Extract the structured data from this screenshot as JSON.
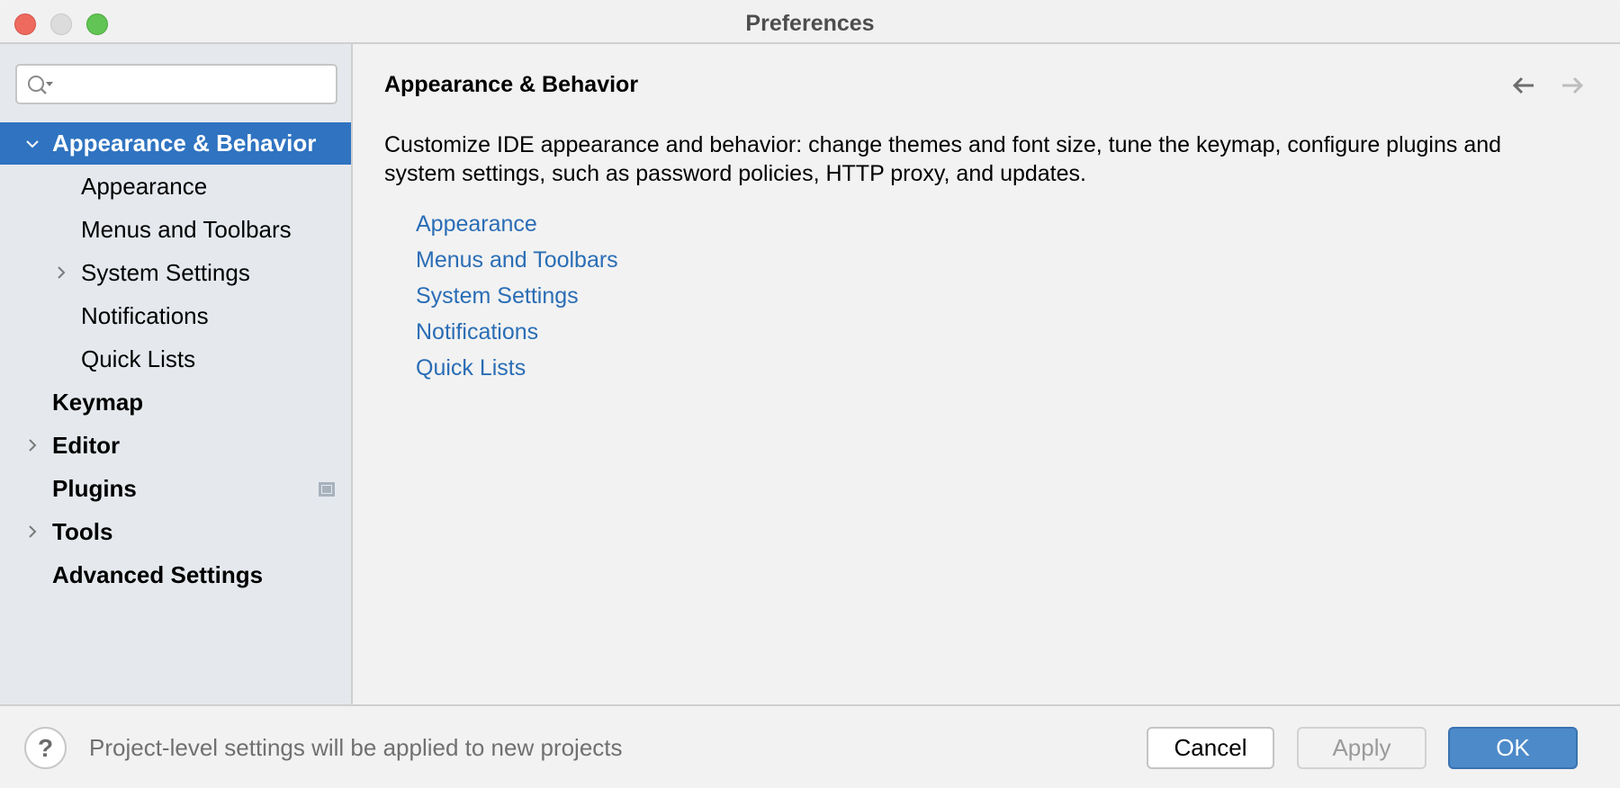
{
  "window": {
    "title": "Preferences",
    "controls": [
      "close",
      "minimize",
      "maximize"
    ]
  },
  "sidebar": {
    "search": {
      "value": "",
      "placeholder": ""
    },
    "tree": [
      {
        "label": "Appearance & Behavior",
        "level": 0,
        "expandable": true,
        "expanded": true,
        "selected": true,
        "bold": true
      },
      {
        "label": "Appearance",
        "level": 1,
        "expandable": false
      },
      {
        "label": "Menus and Toolbars",
        "level": 1,
        "expandable": false
      },
      {
        "label": "System Settings",
        "level": 1,
        "expandable": true,
        "expanded": false
      },
      {
        "label": "Notifications",
        "level": 1,
        "expandable": false
      },
      {
        "label": "Quick Lists",
        "level": 1,
        "expandable": false
      },
      {
        "label": "Keymap",
        "level": 0,
        "expandable": false,
        "bold": true
      },
      {
        "label": "Editor",
        "level": 0,
        "expandable": true,
        "expanded": false,
        "bold": true
      },
      {
        "label": "Plugins",
        "level": 0,
        "expandable": false,
        "bold": true,
        "badge": "window-icon"
      },
      {
        "label": "Tools",
        "level": 0,
        "expandable": true,
        "expanded": false,
        "bold": true
      },
      {
        "label": "Advanced Settings",
        "level": 0,
        "expandable": false,
        "bold": true
      }
    ]
  },
  "content": {
    "title": "Appearance & Behavior",
    "nav": {
      "back_icon": "arrow-left-icon",
      "back_enabled": true,
      "forward_icon": "arrow-right-icon",
      "forward_enabled": false
    },
    "description": "Customize IDE appearance and behavior: change themes and font size, tune the keymap, configure plugins and system settings, such as password policies, HTTP proxy, and updates.",
    "links": [
      "Appearance",
      "Menus and Toolbars",
      "System Settings",
      "Notifications",
      "Quick Lists"
    ]
  },
  "footer": {
    "help_label": "?",
    "note": "Project-level settings will be applied to new projects",
    "buttons": {
      "cancel": "Cancel",
      "apply": "Apply",
      "ok": "OK"
    },
    "apply_enabled": false
  },
  "colors": {
    "accent": "#2f73c1",
    "link": "#2a6db5",
    "ok_button": "#4d8ac9",
    "sidebar_bg": "#e5e9ee",
    "content_bg": "#f2f2f2"
  }
}
